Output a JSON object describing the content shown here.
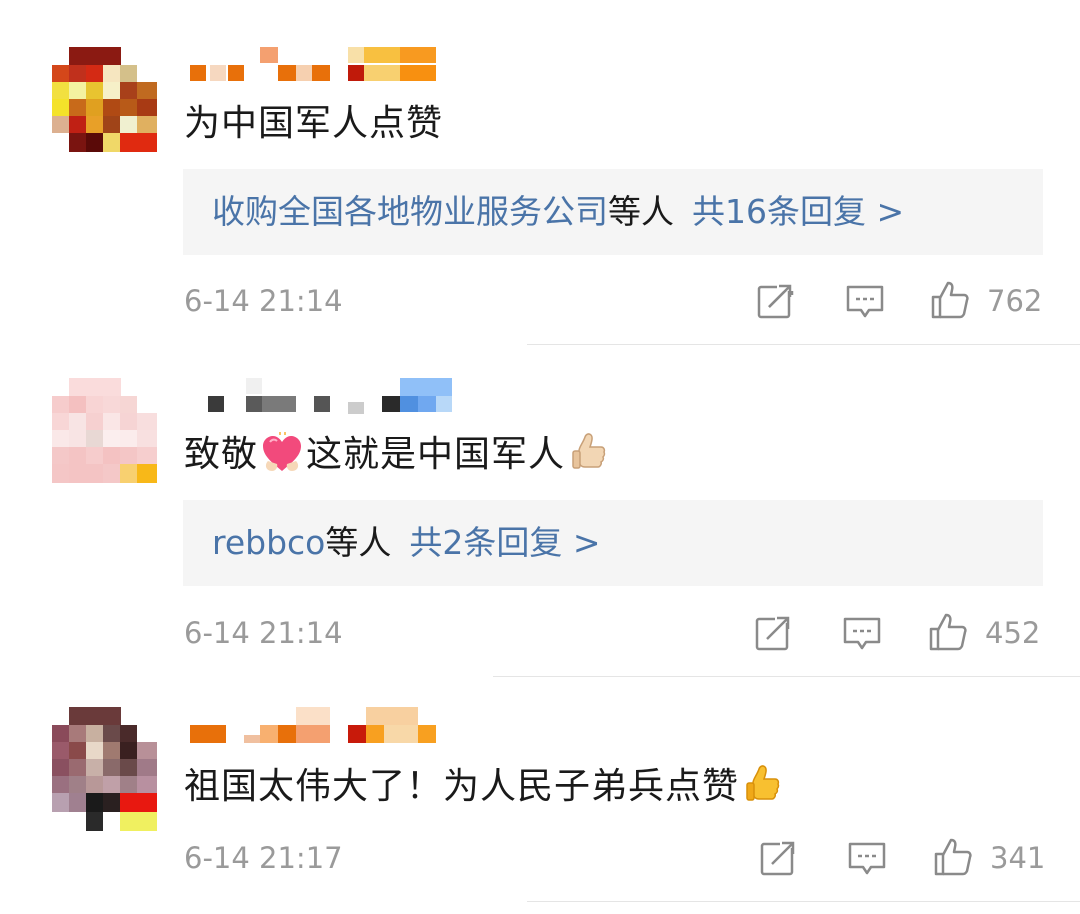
{
  "comments": [
    {
      "text": "为中国军人点赞",
      "reply": {
        "users": "收购全国各地物业服务公司",
        "suffix": "等人",
        "count": "共16条回复 >"
      },
      "time": "6-14 21:14",
      "likes": "762"
    },
    {
      "text_a": "致敬",
      "text_b": "这就是中国军人",
      "emoji_1": "heart-emoji",
      "emoji_2": "thumbs-up-emoji",
      "reply": {
        "users": "rebbco",
        "suffix": "等人",
        "count": "共2条回复 >"
      },
      "time": "6-14 21:14",
      "likes": "452"
    },
    {
      "text": "祖国太伟大了！为人民子弟兵点赞",
      "emoji_1": "thumbs-up-emoji",
      "time": "6-14 21:17",
      "likes": "341"
    }
  ],
  "icons": {
    "share": "share-icon",
    "comment": "comment-icon",
    "like": "like-icon"
  },
  "colors": {
    "link": "#4a74a8",
    "meta": "#9a9a9a",
    "reply_bg": "#f5f5f5"
  }
}
